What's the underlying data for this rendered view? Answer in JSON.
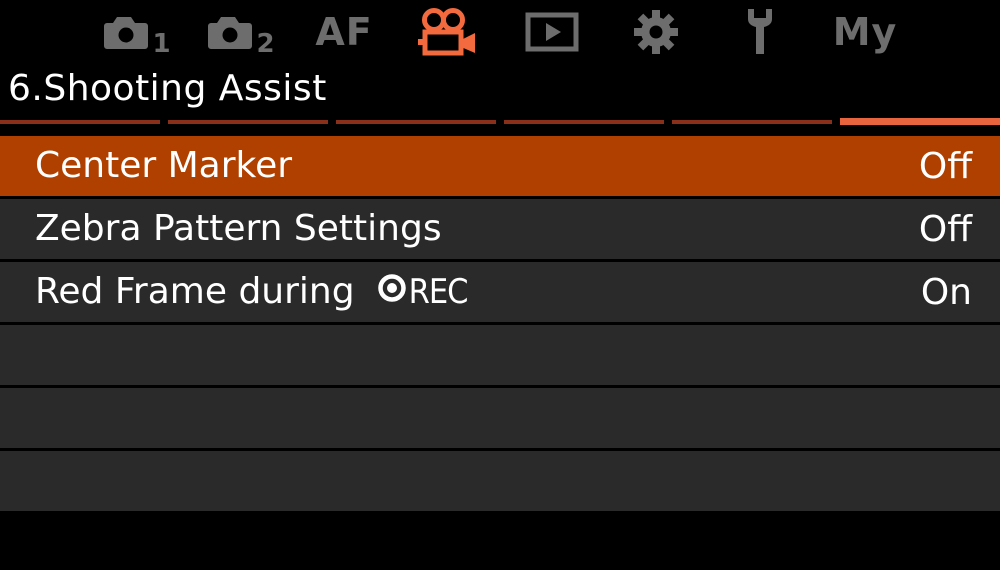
{
  "tabs": [
    {
      "id": "shooting-1",
      "icon": "camera-icon",
      "sub": "1",
      "active": false
    },
    {
      "id": "shooting-2",
      "icon": "camera-icon",
      "sub": "2",
      "active": false
    },
    {
      "id": "af",
      "label": "AF",
      "active": false
    },
    {
      "id": "video",
      "icon": "movie-camera-icon",
      "active": true
    },
    {
      "id": "playback",
      "icon": "play-icon",
      "active": false
    },
    {
      "id": "settings",
      "icon": "gear-icon",
      "active": false
    },
    {
      "id": "custom",
      "icon": "wrench-icon",
      "active": false
    },
    {
      "id": "my-menu",
      "label": "My",
      "active": false
    }
  ],
  "colors": {
    "active_tab": "#f26a3d",
    "inactive_tab": "#6d6d6d",
    "selected_row": "#b04000",
    "row_bg": "#2a2a2a",
    "page_indicator": "#8a2f1a",
    "page_indicator_active": "#e8643e"
  },
  "page": {
    "title": "6.Shooting Assist",
    "current_page": 6,
    "total_pages": 6
  },
  "menu": {
    "items": [
      {
        "label": "Center Marker",
        "value": "Off",
        "selected": true
      },
      {
        "label": "Zebra Pattern Settings",
        "value": "Off",
        "selected": false
      },
      {
        "label_prefix": "Red Frame during",
        "rec_icon": "record-icon",
        "label_suffix": "REC",
        "value": "On",
        "selected": false
      }
    ],
    "empty_rows": 3
  }
}
